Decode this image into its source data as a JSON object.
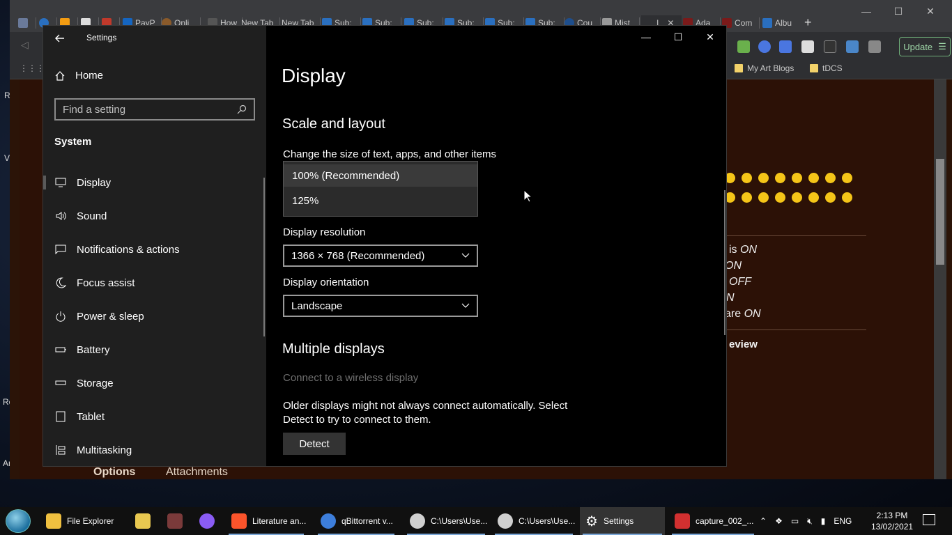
{
  "browser": {
    "tabs": [
      "",
      "",
      "",
      "",
      "PayP",
      "Onli",
      "How",
      "New Tab",
      "New Tab",
      "Sub:",
      "Sub:",
      "Sub:",
      "Sub:",
      "Sub:",
      "Sub:",
      "Cou",
      "Mist",
      "I",
      "Ada",
      "Com",
      "Albu"
    ],
    "bookmarks": [
      "A",
      "My Art Blogs",
      "tDCS"
    ],
    "update_label": "Update",
    "page": {
      "status_lines": [
        {
          "prefix": "is ",
          "state": "ON"
        },
        {
          "prefix": "",
          "state": "ON"
        },
        {
          "prefix": "",
          "state": "OFF"
        },
        {
          "prefix": "",
          "state": "N"
        },
        {
          "prefix": "are ",
          "state": "ON"
        }
      ],
      "review_label": "eview",
      "options_label": "Options",
      "attachments_label": "Attachments"
    },
    "desktop_left_labels": [
      "R",
      "V",
      "Ro",
      "Ar"
    ]
  },
  "settings": {
    "window_title": "Settings",
    "home_label": "Home",
    "search_placeholder": "Find a setting",
    "section": "System",
    "nav": [
      {
        "label": "Display",
        "icon": "monitor-icon"
      },
      {
        "label": "Sound",
        "icon": "speaker-icon"
      },
      {
        "label": "Notifications & actions",
        "icon": "message-icon"
      },
      {
        "label": "Focus assist",
        "icon": "moon-icon"
      },
      {
        "label": "Power & sleep",
        "icon": "power-icon"
      },
      {
        "label": "Battery",
        "icon": "battery-icon"
      },
      {
        "label": "Storage",
        "icon": "storage-icon"
      },
      {
        "label": "Tablet",
        "icon": "tablet-icon"
      },
      {
        "label": "Multitasking",
        "icon": "multitask-icon"
      }
    ],
    "page_title": "Display",
    "scale_heading": "Scale and layout",
    "scale_label": "Change the size of text, apps, and other items",
    "scale_options": [
      "100% (Recommended)",
      "125%"
    ],
    "resolution_label": "Display resolution",
    "resolution_value": "1366 × 768 (Recommended)",
    "orientation_label": "Display orientation",
    "orientation_value": "Landscape",
    "multiple_heading": "Multiple displays",
    "wireless_link": "Connect to a wireless display",
    "older_text": "Older displays might not always connect automatically. Select Detect to try to connect to them.",
    "detect_label": "Detect"
  },
  "taskbar": {
    "items": [
      {
        "label": "File Explorer",
        "color": "#f0c040"
      },
      {
        "label": "",
        "color": "#e8c850"
      },
      {
        "label": "",
        "color": "#7a3a3a"
      },
      {
        "label": "",
        "color": "#8a5cf5"
      },
      {
        "label": "Literature an...",
        "color": "#fb542b"
      },
      {
        "label": "qBittorrent v...",
        "color": "#3d7edb"
      },
      {
        "label": "C:\\Users\\Use...",
        "color": "#d0d0d0"
      },
      {
        "label": "C:\\Users\\Use...",
        "color": "#d0d0d0"
      },
      {
        "label": "Settings",
        "color": "#ffffff"
      },
      {
        "label": "capture_002_...",
        "color": "#d23030"
      }
    ],
    "language": "ENG",
    "time": "2:13 PM",
    "date": "13/02/2021"
  }
}
